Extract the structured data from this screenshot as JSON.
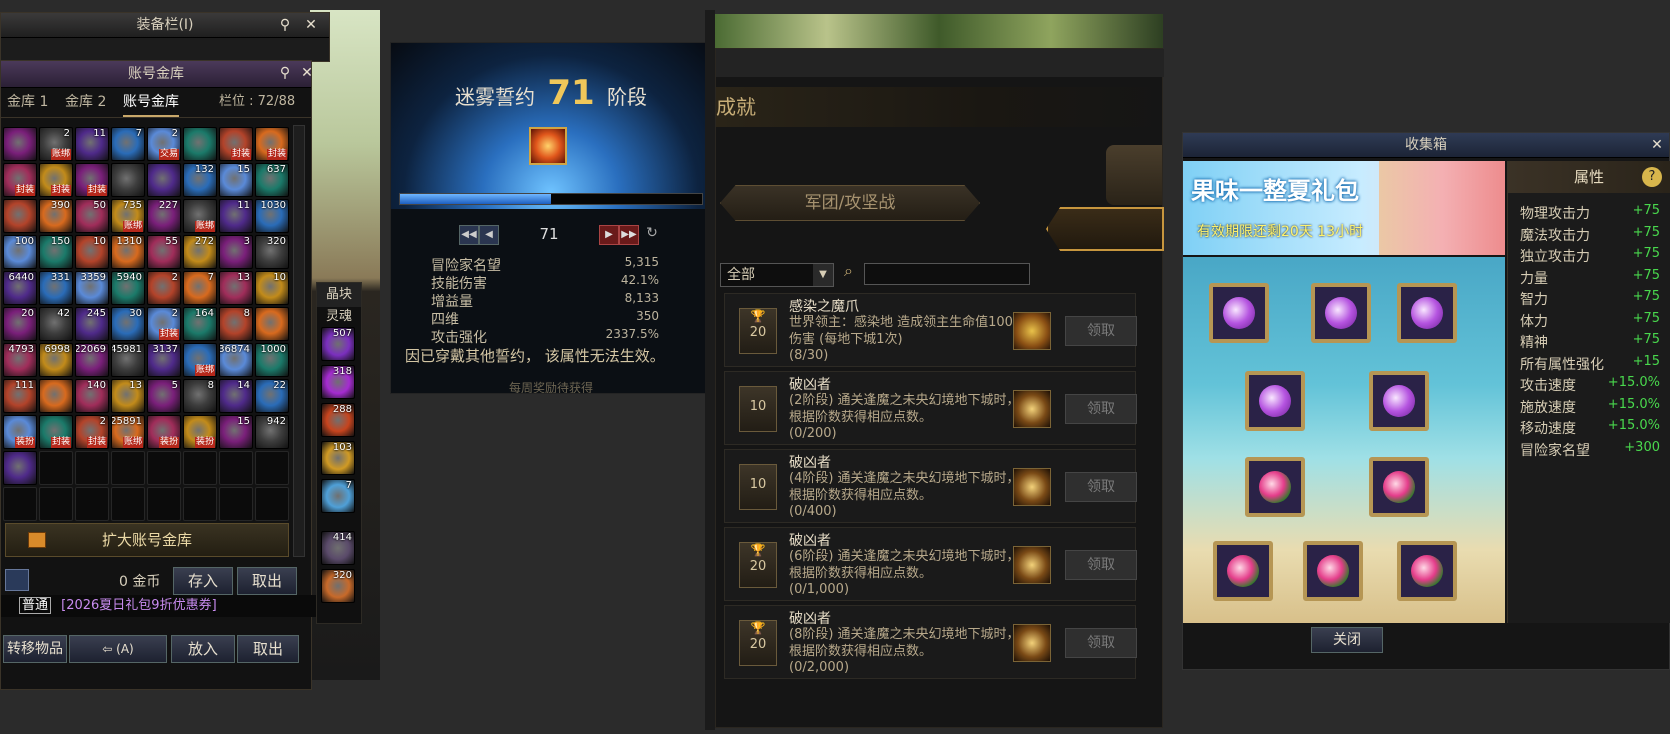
{
  "equip": {
    "title": "装备栏(I)"
  },
  "vault": {
    "title": "账号金库",
    "tabs": [
      "金库 1",
      "金库 2",
      "账号金库"
    ],
    "slots_label": "栏位 : 72/88",
    "expand_label": "扩大账号金库",
    "gold": "0 金币",
    "deposit": "存入",
    "withdraw": "取出",
    "transfer": "转移物品",
    "transfer_mode": "(A)",
    "put_in": "放入",
    "take_out": "取出",
    "chat_channel": "普通",
    "chat_link": "[2026夏日礼包9折优惠券]",
    "side_label_1": "晶块",
    "side_label_2": "灵魂",
    "items": [
      {
        "count": "",
        "tag": ""
      },
      {
        "count": "2",
        "tag": "账绑"
      },
      {
        "count": "11",
        "tag": ""
      },
      {
        "count": "7",
        "tag": ""
      },
      {
        "count": "2",
        "tag": "交易"
      },
      {
        "count": "",
        "tag": ""
      },
      {
        "count": "",
        "tag": "封装"
      },
      {
        "count": "",
        "tag": "封装"
      },
      {
        "count": "",
        "tag": "封装"
      },
      {
        "count": "",
        "tag": "封装"
      },
      {
        "count": "",
        "tag": "封装"
      },
      {
        "count": "",
        "tag": ""
      },
      {
        "count": "",
        "tag": ""
      },
      {
        "count": "132",
        "tag": ""
      },
      {
        "count": "15",
        "tag": ""
      },
      {
        "count": "637",
        "tag": ""
      },
      {
        "count": "",
        "tag": ""
      },
      {
        "count": "390",
        "tag": ""
      },
      {
        "count": "50",
        "tag": ""
      },
      {
        "count": "735",
        "tag": "账绑"
      },
      {
        "count": "227",
        "tag": ""
      },
      {
        "count": "",
        "tag": "账绑"
      },
      {
        "count": "11",
        "tag": ""
      },
      {
        "count": "1030",
        "tag": ""
      },
      {
        "count": "100",
        "tag": ""
      },
      {
        "count": "150",
        "tag": ""
      },
      {
        "count": "10",
        "tag": ""
      },
      {
        "count": "1310",
        "tag": ""
      },
      {
        "count": "55",
        "tag": ""
      },
      {
        "count": "272",
        "tag": ""
      },
      {
        "count": "3",
        "tag": ""
      },
      {
        "count": "320",
        "tag": ""
      },
      {
        "count": "6440",
        "tag": ""
      },
      {
        "count": "331",
        "tag": ""
      },
      {
        "count": "3359",
        "tag": ""
      },
      {
        "count": "5940",
        "tag": ""
      },
      {
        "count": "2",
        "tag": ""
      },
      {
        "count": "7",
        "tag": ""
      },
      {
        "count": "13",
        "tag": ""
      },
      {
        "count": "10",
        "tag": ""
      },
      {
        "count": "20",
        "tag": ""
      },
      {
        "count": "42",
        "tag": ""
      },
      {
        "count": "245",
        "tag": ""
      },
      {
        "count": "30",
        "tag": ""
      },
      {
        "count": "2",
        "tag": "封装"
      },
      {
        "count": "164",
        "tag": ""
      },
      {
        "count": "8",
        "tag": ""
      },
      {
        "count": "",
        "tag": ""
      },
      {
        "count": "4793",
        "tag": ""
      },
      {
        "count": "6998",
        "tag": ""
      },
      {
        "count": "22069",
        "tag": ""
      },
      {
        "count": "45981",
        "tag": ""
      },
      {
        "count": "3137",
        "tag": ""
      },
      {
        "count": "",
        "tag": "账绑"
      },
      {
        "count": "36874",
        "tag": ""
      },
      {
        "count": "1000",
        "tag": ""
      },
      {
        "count": "111",
        "tag": ""
      },
      {
        "count": "",
        "tag": ""
      },
      {
        "count": "140",
        "tag": ""
      },
      {
        "count": "13",
        "tag": ""
      },
      {
        "count": "5",
        "tag": ""
      },
      {
        "count": "8",
        "tag": ""
      },
      {
        "count": "14",
        "tag": ""
      },
      {
        "count": "22",
        "tag": ""
      },
      {
        "count": "",
        "tag": "装扮"
      },
      {
        "count": "",
        "tag": "封装"
      },
      {
        "count": "2",
        "tag": "封装"
      },
      {
        "count": "25891",
        "tag": "账绑"
      },
      {
        "count": "",
        "tag": "装扮"
      },
      {
        "count": "",
        "tag": "装扮"
      },
      {
        "count": "15",
        "tag": ""
      },
      {
        "count": "942",
        "tag": ""
      },
      {
        "count": "",
        "tag": ""
      }
    ],
    "side_counts": [
      "507",
      "318",
      "288",
      "103",
      "7",
      "414",
      "320"
    ]
  },
  "pact": {
    "title_prefix": "迷雾誓约",
    "level": "71",
    "title_suffix": "阶段",
    "page": "71",
    "progress": 0.5,
    "stats": [
      {
        "label": "冒险家名望",
        "value": "5,315"
      },
      {
        "label": "技能伤害",
        "value": "42.1%"
      },
      {
        "label": "增益量",
        "value": "8,133"
      },
      {
        "label": "四维",
        "value": "350"
      },
      {
        "label": "攻击强化",
        "value": "2337.5%"
      }
    ],
    "notice": "因已穿戴其他誓约， 该属性无法生效。",
    "footer": "每周奖励待获得"
  },
  "achievement": {
    "header": "成就",
    "category": "军团/攻坚战",
    "filter": "全部",
    "search_placeholder": "",
    "rows": [
      {
        "badge": "20",
        "trophy": true,
        "title": "感染之魔爪",
        "desc": "世界领主：感染地        造成领主生命值100%伤害 (每地下城1次)",
        "progress": "(8/30)",
        "claim": "领取",
        "icon": "star"
      },
      {
        "badge": "10",
        "trophy": false,
        "title": "破凶者",
        "desc": "(2阶段) 通关逢魔之未央幻境地下城时，根据阶数获得相应点数。",
        "progress": "(0/200)",
        "claim": "领取",
        "icon": "mask"
      },
      {
        "badge": "10",
        "trophy": false,
        "title": "破凶者",
        "desc": "(4阶段) 通关逢魔之未央幻境地下城时，根据阶数获得相应点数。",
        "progress": "(0/400)",
        "claim": "领取",
        "icon": "mask"
      },
      {
        "badge": "20",
        "trophy": true,
        "title": "破凶者",
        "desc": "(6阶段) 通关逢魔之未央幻境地下城时，根据阶数获得相应点数。",
        "progress": "(0/1,000)",
        "claim": "领取",
        "icon": "mask"
      },
      {
        "badge": "20",
        "trophy": true,
        "title": "破凶者",
        "desc": "(8阶段) 通关逢魔之未央幻境地下城时，根据阶数获得相应点数。",
        "progress": "(0/2,000)",
        "claim": "领取",
        "icon": "mask"
      }
    ]
  },
  "collection": {
    "title": "收集箱",
    "banner_title": "果味一整夏礼包",
    "banner_sub": "有效期限还剩20天 13小时",
    "attr_header": "属性",
    "help": "?",
    "close": "关闭",
    "attrs": [
      {
        "label": "物理攻击力",
        "value": "+75"
      },
      {
        "label": "魔法攻击力",
        "value": "+75"
      },
      {
        "label": "独立攻击力",
        "value": "+75"
      },
      {
        "label": "力量",
        "value": "+75"
      },
      {
        "label": "智力",
        "value": "+75"
      },
      {
        "label": "体力",
        "value": "+75"
      },
      {
        "label": "精神",
        "value": "+75"
      },
      {
        "label": "所有属性强化",
        "value": "+15"
      },
      {
        "label": "攻击速度",
        "value": "+15.0%"
      },
      {
        "label": "施放速度",
        "value": "+15.0%"
      },
      {
        "label": "移动速度",
        "value": "+15.0%"
      },
      {
        "label": "冒险家名望",
        "value": "+300"
      }
    ]
  }
}
